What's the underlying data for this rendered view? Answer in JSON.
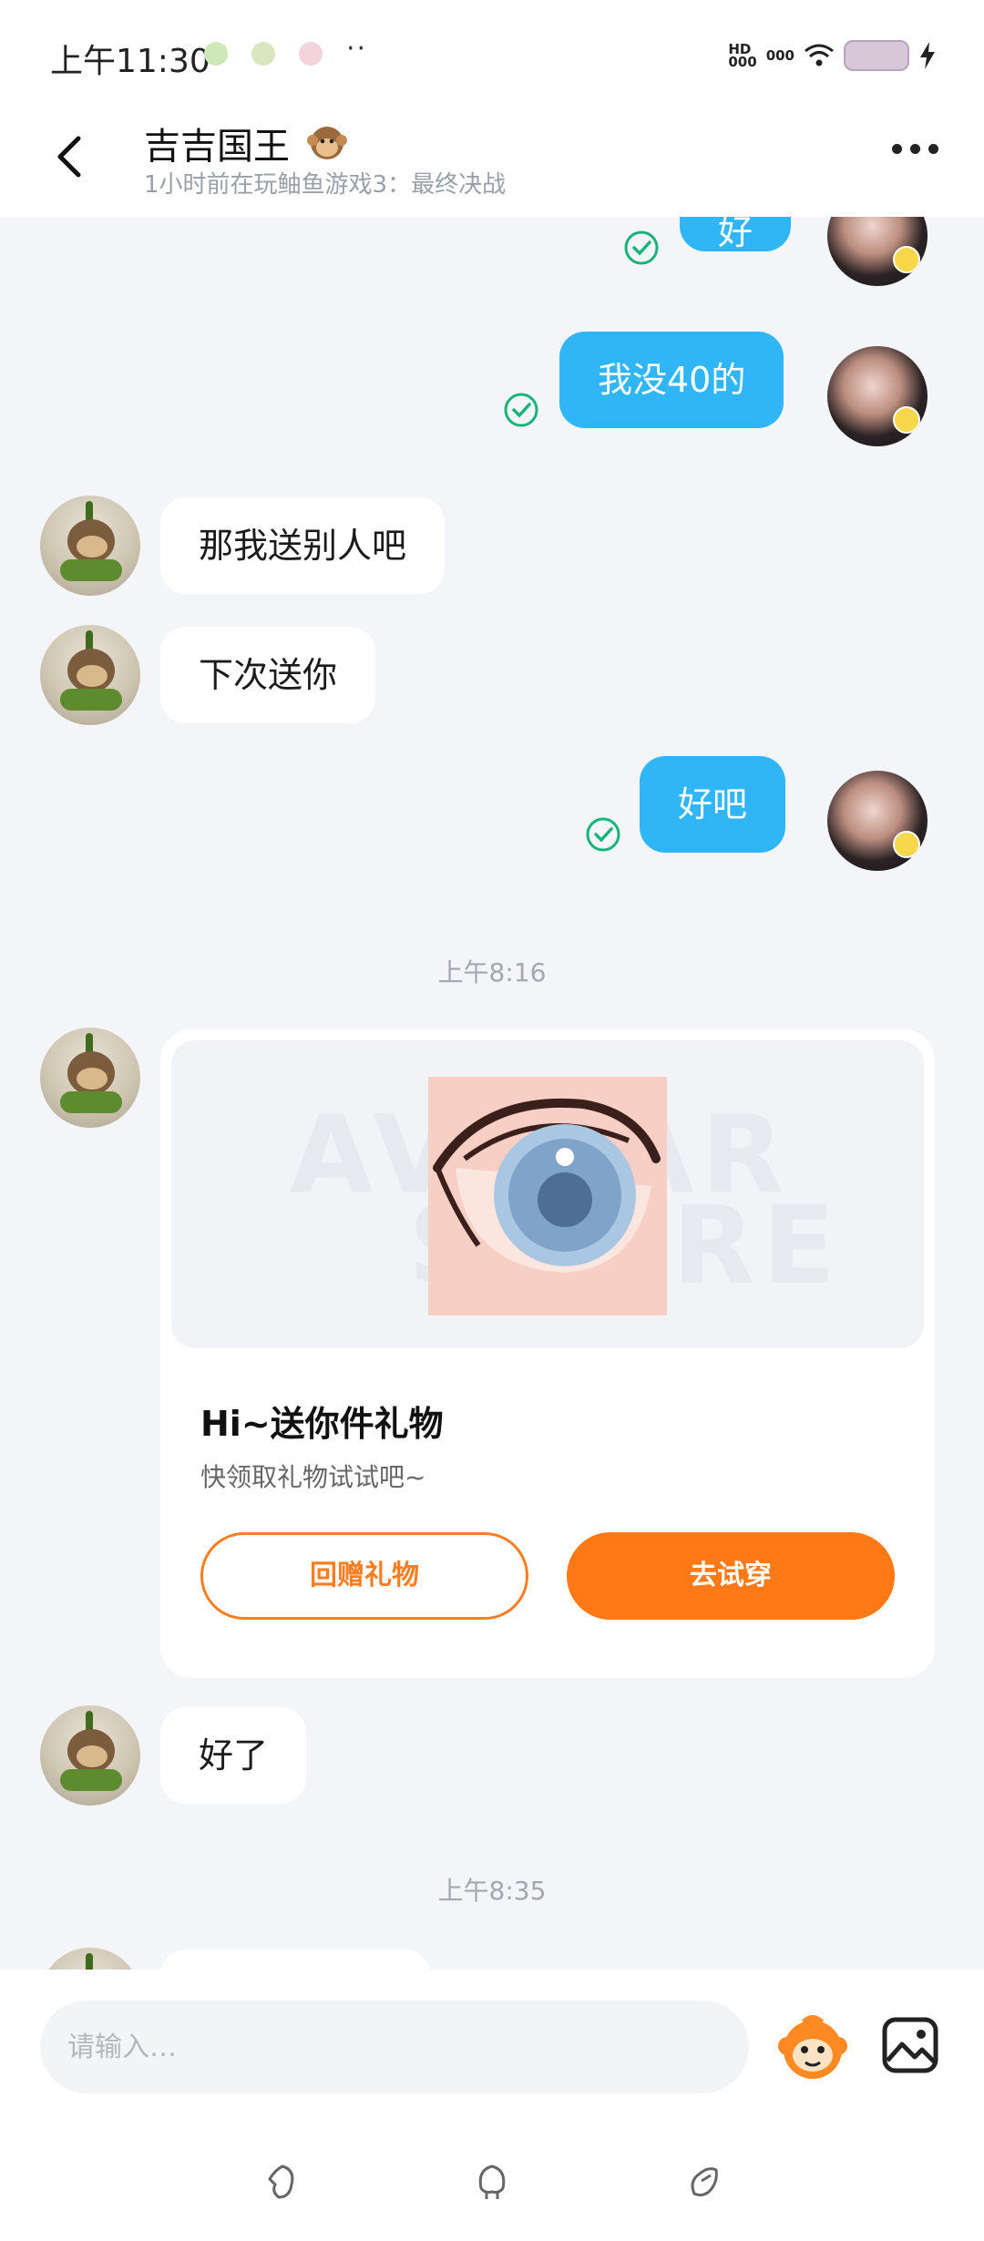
{
  "status_bar": {
    "time": "上午11:30",
    "dots": "··",
    "network_label_1": "HD",
    "network_label_2": "000",
    "network_label_3": "000",
    "battery_color": "#d8c6d9"
  },
  "header": {
    "title": "吉吉国王",
    "title_icon": "monkey-emoji",
    "subtitle": "1小时前在玩鲉鱼游戏3：最终决战",
    "back_icon": "chevron-left-icon",
    "more_icon": "more-horizontal-icon"
  },
  "messages": {
    "m0": "好",
    "m1": "我没40的",
    "m2": "那我送别人吧",
    "m3": "下次送你",
    "m4": "好吧",
    "m6": "好了"
  },
  "timestamps": {
    "t1": "上午8:16",
    "t2": "上午8:35"
  },
  "gift_card": {
    "watermark_line1": "AVATAR",
    "watermark_line2": "STORE",
    "title": "Hi~送你件礼物",
    "subtitle": "快领取礼物试试吧~",
    "return_button": "回赠礼物",
    "try_button": "去试穿",
    "accent_color": "#ff7a16"
  },
  "input": {
    "placeholder": "请输入…",
    "sticker_icon": "monkey-sticker-icon",
    "image_icon": "image-icon"
  },
  "colors": {
    "outgoing_bubble": "#30b6f7",
    "incoming_bubble": "#ffffff",
    "read_check": "#19b37a",
    "background": "#f3f5f9"
  }
}
